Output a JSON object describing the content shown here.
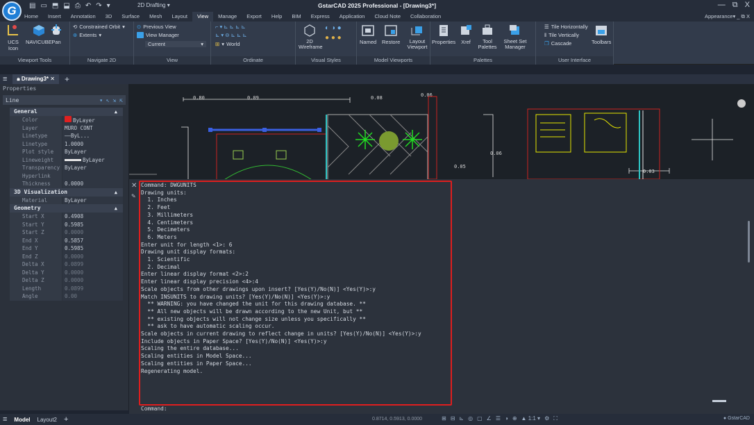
{
  "app": {
    "logo": "G",
    "title": "GstarCAD 2025 Professional - [Drawing3*]",
    "workspace": "2D Drafting",
    "qat_icons": [
      "new-icon",
      "open-icon",
      "save-icon",
      "save-as-icon",
      "print-icon",
      "undo-icon",
      "redo-icon"
    ],
    "window_controls": [
      "—",
      "⧉",
      "X"
    ]
  },
  "ribbon_tabs": [
    "Home",
    "Insert",
    "Annotation",
    "3D",
    "Surface",
    "Mesh",
    "Layout",
    "View",
    "Manage",
    "Export",
    "Help",
    "BIM",
    "Express",
    "Application",
    "Cloud Note",
    "Collaboration"
  ],
  "active_tab": "View",
  "appearance_label": "Appearance▾",
  "ribbon": {
    "viewport_tools": {
      "title": "Viewport Tools",
      "ucs": "UCS Icon",
      "navicube": "NAVICUBE",
      "pan": "Pan"
    },
    "navigate_2d": {
      "title": "Navigate 2D",
      "orbit": "Constrained Orbit",
      "extents": "Extents"
    },
    "view": {
      "title": "View",
      "previous": "Previous View",
      "manager": "View Manager",
      "current": "Current"
    },
    "ordinate": {
      "title": "Ordinate",
      "world": "World"
    },
    "visual_styles": {
      "title": "Visual Styles",
      "wireframe": "2D Wireframe"
    },
    "model_viewports": {
      "title": "Model Viewports",
      "named": "Named",
      "restore": "Restore",
      "layout_viewport": "Layout Viewport"
    },
    "palettes": {
      "title": "Palettes",
      "properties": "Properties",
      "xref": "Xref",
      "tool_palettes": "Tool Palettes",
      "sheet_set": "Sheet Set Manager"
    },
    "user_interface": {
      "title": "User Interface",
      "tile_h": "Tile Horizontally",
      "tile_v": "Tile Vertically",
      "cascade": "Cascade",
      "toolbars": "Toolbars"
    }
  },
  "doc_tab": "Drawing3*",
  "properties": {
    "header": "Properties",
    "selection": "Line",
    "general": {
      "title": "General",
      "rows": [
        {
          "k": "Color",
          "v": "ByLayer"
        },
        {
          "k": "Layer",
          "v": "MURO CONT"
        },
        {
          "k": "Linetype",
          "v": "——ByL..."
        },
        {
          "k": "Linetype scale",
          "v": "1.0000"
        },
        {
          "k": "Plot style",
          "v": "ByLayer"
        },
        {
          "k": "Lineweight",
          "v": "ByLayer"
        },
        {
          "k": "Transparency",
          "v": "ByLayer"
        },
        {
          "k": "Hyperlink",
          "v": ""
        },
        {
          "k": "Thickness",
          "v": "0.0000"
        }
      ]
    },
    "visualization": {
      "title": "3D Visualization",
      "rows": [
        {
          "k": "Material",
          "v": "ByLayer"
        }
      ]
    },
    "geometry": {
      "title": "Geometry",
      "rows": [
        {
          "k": "Start X",
          "v": "0.4908"
        },
        {
          "k": "Start Y",
          "v": "0.5985"
        },
        {
          "k": "Start Z",
          "v": "0.0000"
        },
        {
          "k": "End X",
          "v": "0.5857"
        },
        {
          "k": "End Y",
          "v": "0.5985"
        },
        {
          "k": "End Z",
          "v": "0.0000"
        },
        {
          "k": "Delta X",
          "v": "0.0899"
        },
        {
          "k": "Delta Y",
          "v": "0.0000"
        },
        {
          "k": "Delta Z",
          "v": "0.0000"
        },
        {
          "k": "Length",
          "v": "0.0899"
        },
        {
          "k": "Angle",
          "v": "0.00"
        }
      ]
    }
  },
  "canvas": {
    "dim_labels": [
      "0.80",
      "0.09",
      "0.08",
      "0.06",
      "0.06",
      "0.05",
      "0.03"
    ]
  },
  "command_history": [
    "Command: DWGUNITS",
    "Drawing units:",
    "  1. Inches",
    "  2. Feet",
    "  3. Millimeters",
    "  4. Centimeters",
    "  5. Decimeters",
    "  6. Meters",
    "Enter unit for length <1>: 6",
    "Drawing unit display formats:",
    "  1. Scientific",
    "  2. Decimal",
    "Enter linear display format <2>:2",
    "Enter linear display precision <4>:4",
    "Scale objects from other drawings upon insert? [Yes(Y)/No(N)] <Yes(Y)>:y",
    "Match INSUNITS to drawing units? [Yes(Y)/No(N)] <Yes(Y)>:y",
    "  ** WARNING: you have changed the unit for this drawing database. **",
    "  ** All new objects will be drawn according to the new Unit, but **",
    "  ** existing objects will not change size unless you specifically **",
    "  ** ask to have automatic scaling occur.",
    "Scale objects in current drawing to reflect change in units? [Yes(Y)/No(N)] <Yes(Y)>:y",
    "Include objects in Paper Space? [Yes(Y)/No(N)] <Yes(Y)>:y",
    "Scaling the entire database...",
    "Scaling entities in Model Space...",
    "Scaling entities in Paper Space...",
    "Regenerating model."
  ],
  "command_prompt": "Command:",
  "status": {
    "model": "Model",
    "layout": "Layout2",
    "coords": "0.8714, 0.5913, 0.0000",
    "scale": "1:1",
    "brand": "GstarCAD"
  },
  "colors": {
    "highlight_border": "#e01e1e",
    "accent": "#1f7ed6"
  }
}
